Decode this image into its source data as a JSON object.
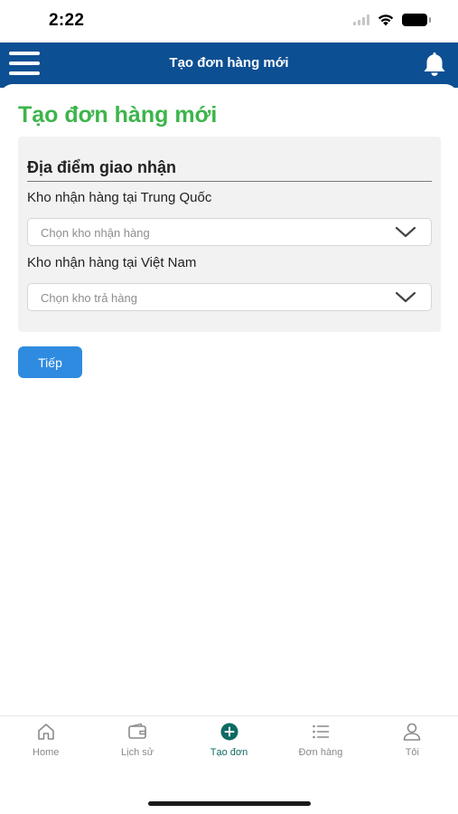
{
  "status_bar": {
    "time": "2:22",
    "icons": [
      "signal-icon",
      "wifi-icon",
      "battery-icon"
    ]
  },
  "header": {
    "title": "Tạo đơn hàng mới",
    "menu_icon": "hamburger-menu-icon",
    "bell_icon": "bell-icon",
    "background_color": "#0d4f93"
  },
  "page": {
    "title": "Tạo đơn hàng mới",
    "title_color": "#3cb54a"
  },
  "section": {
    "heading": "Địa điểm giao nhận",
    "fields": [
      {
        "label": "Kho nhận hàng tại Trung Quốc",
        "placeholder": "Chọn kho nhận hàng",
        "icon": "chevron-down-icon"
      },
      {
        "label": "Kho nhận hàng tại Việt Nam",
        "placeholder": "Chọn kho trả hàng",
        "icon": "chevron-down-icon"
      }
    ]
  },
  "next_button": {
    "label": "Tiếp",
    "color": "#2f8be0"
  },
  "tab_bar": {
    "active_color": "#0e6b63",
    "tabs": [
      {
        "label": "Home",
        "icon": "home-icon"
      },
      {
        "label": "Lịch sử",
        "icon": "wallet-icon"
      },
      {
        "label": "Tạo đơn",
        "icon": "add-circle-icon",
        "active": true
      },
      {
        "label": "Đơn hàng",
        "icon": "list-icon"
      },
      {
        "label": "Tôi",
        "icon": "user-icon"
      }
    ]
  }
}
